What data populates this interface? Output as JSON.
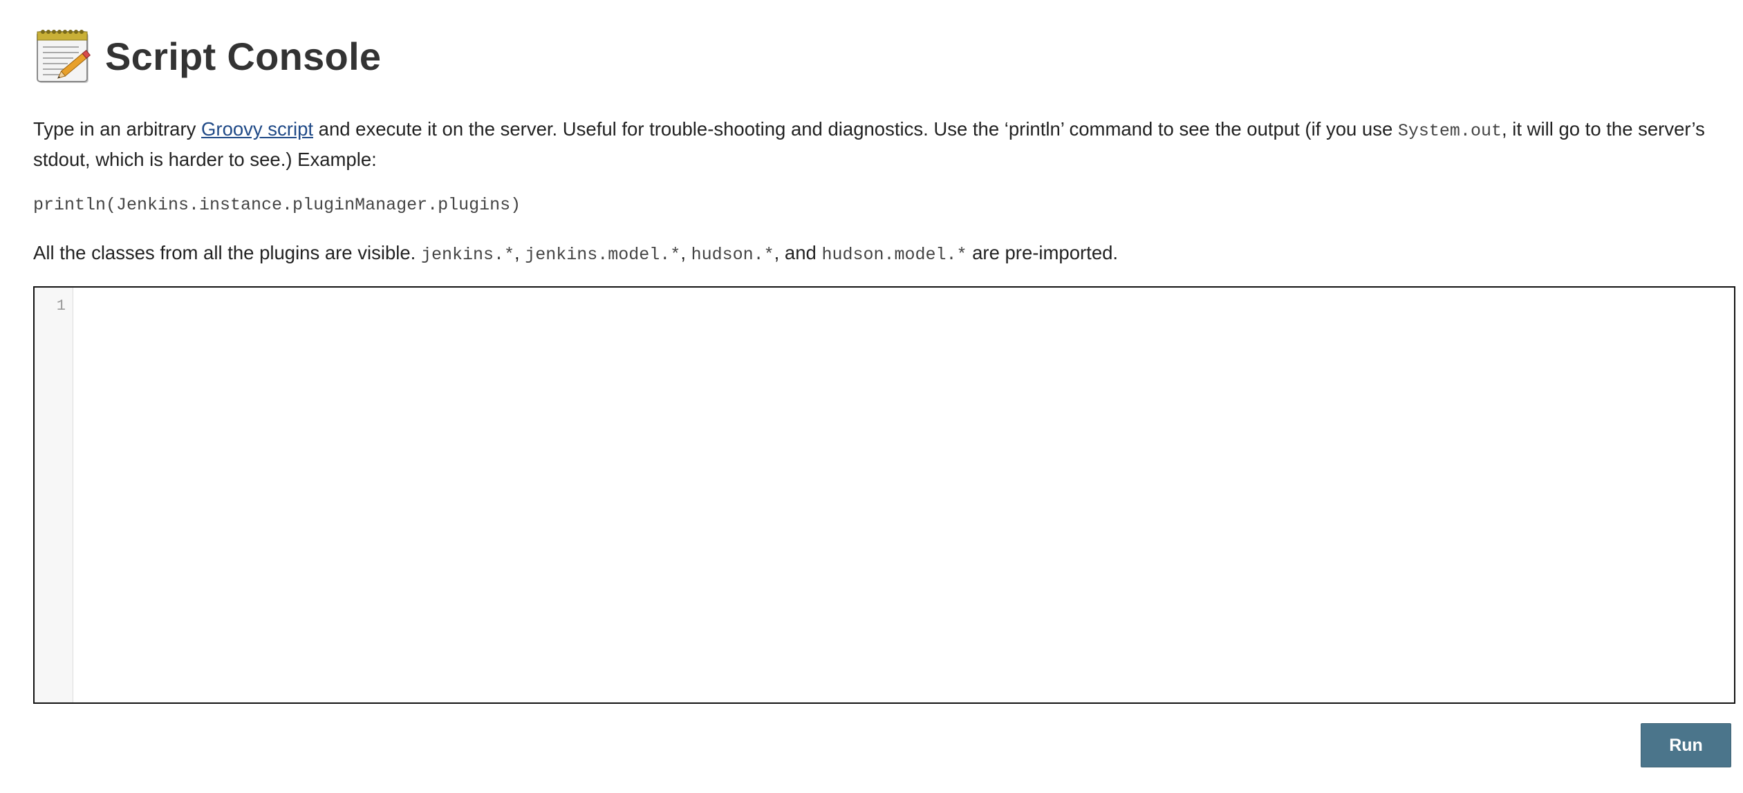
{
  "page": {
    "title": "Script Console",
    "icon": "notepad-pencil-icon"
  },
  "intro": {
    "text_before_link": "Type in an arbitrary ",
    "link_text": "Groovy script",
    "text_after_link": " and execute it on the server. Useful for trouble-shooting and diagnostics. Use the ‘println’ command to see the output (if you use ",
    "code_system_out": "System.out",
    "text_end": ", it will go to the server’s stdout, which is harder to see.) Example:"
  },
  "example_code": "println(Jenkins.instance.pluginManager.plugins)",
  "classes_note": {
    "text_before": "All the classes from all the plugins are visible. ",
    "code_1": "jenkins.*",
    "sep_1": ", ",
    "code_2": "jenkins.model.*",
    "sep_2": ", ",
    "code_3": "hudson.*",
    "sep_3": ", and ",
    "code_4": "hudson.model.*",
    "text_after": " are pre-imported."
  },
  "editor": {
    "line_numbers": [
      "1"
    ],
    "content": ""
  },
  "actions": {
    "run_label": "Run"
  },
  "colors": {
    "run_button_bg": "#4b758b",
    "link": "#204a87",
    "title": "#333333"
  }
}
